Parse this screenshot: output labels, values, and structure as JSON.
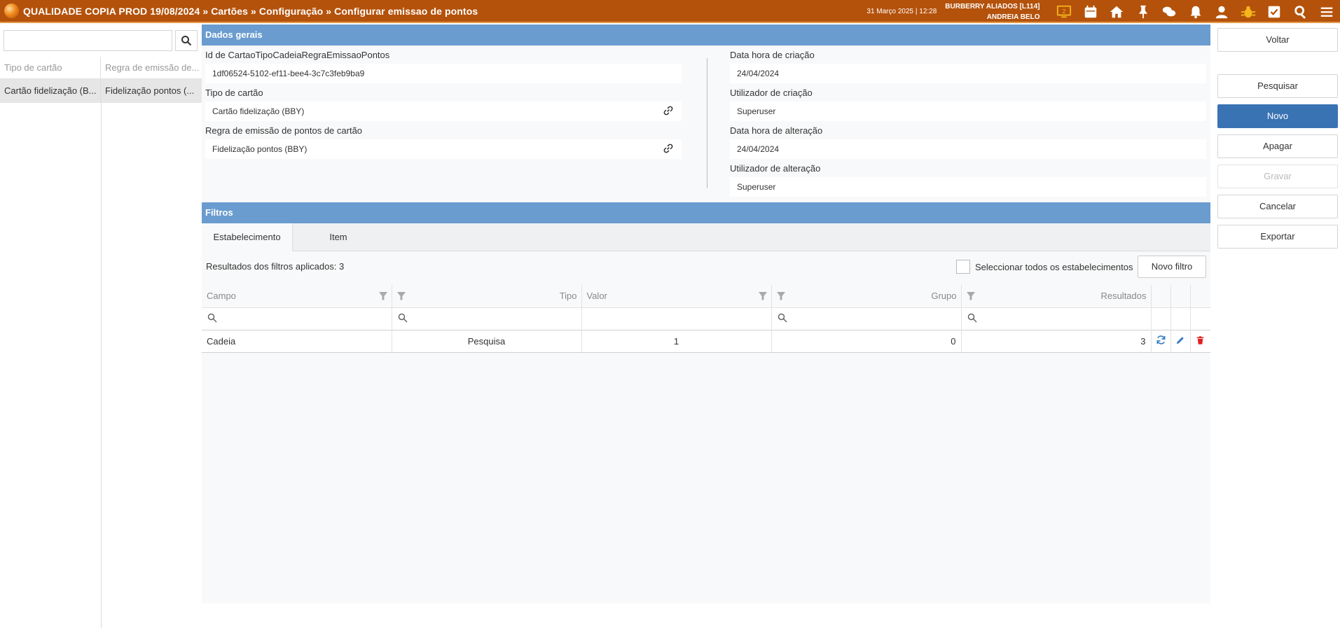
{
  "topbar": {
    "breadcrumb": "QUALIDADE COPIA PROD 19/08/2024 » Cartões » Configuração » Configurar emissao de pontos",
    "datetime": "31 Março 2025 | 12:28",
    "company": "BURBERRY ALIADOS [L114]",
    "user": "ANDREIA BELO",
    "icons": [
      "monitor-badge-icon",
      "calendar-icon",
      "home-icon",
      "pin-icon",
      "chat-icon",
      "bell-icon",
      "user-icon",
      "bug-icon",
      "checkbox-icon",
      "search-icon",
      "menu-icon"
    ],
    "badge_count": "2",
    "badge_color": "#f5b61c",
    "bar_color": "#b4520b"
  },
  "left": {
    "search_value": "",
    "columns": [
      "Tipo de cartão",
      "Regra de emissão de..."
    ],
    "rows": [
      [
        "Cartão fidelização (B...",
        "Fidelização pontos (..."
      ]
    ]
  },
  "general": {
    "title": "Dados gerais",
    "id_label": "Id de CartaoTipoCadeiaRegraEmissaoPontos",
    "id_value": "1df06524-5102-ef11-bee4-3c7c3feb9ba9",
    "tipo_label": "Tipo de cartão",
    "tipo_value": "Cartão fidelização (BBY)",
    "regra_label": "Regra de emissão de pontos de cartão",
    "regra_value": "Fidelização pontos (BBY)",
    "criacao_label": "Data hora de criação",
    "criacao_value": "24/04/2024",
    "ucriacao_label": "Utilizador de criação",
    "ucriacao_value": "Superuser",
    "alteracao_label": "Data hora de alteração",
    "alteracao_value": "24/04/2024",
    "ualteracao_label": "Utilizador de alteração",
    "ualteracao_value": "Superuser"
  },
  "filters": {
    "title": "Filtros",
    "tabs": [
      "Estabelecimento",
      "Item"
    ],
    "results_text": "Resultados dos filtros aplicados: 3",
    "select_all_label": "Seleccionar todos os estabelecimentos",
    "novo_filtro": "Novo filtro",
    "columns": [
      "Campo",
      "Tipo",
      "Valor",
      "Grupo",
      "Resultados"
    ],
    "rows": [
      {
        "campo": "Cadeia",
        "tipo": "Pesquisa",
        "valor": "1",
        "grupo": "0",
        "resultados": "3"
      }
    ]
  },
  "actions": {
    "voltar": "Voltar",
    "pesquisar": "Pesquisar",
    "novo": "Novo",
    "apagar": "Apagar",
    "gravar": "Gravar",
    "cancelar": "Cancelar",
    "exportar": "Exportar",
    "primary_color": "#3a73b3"
  }
}
